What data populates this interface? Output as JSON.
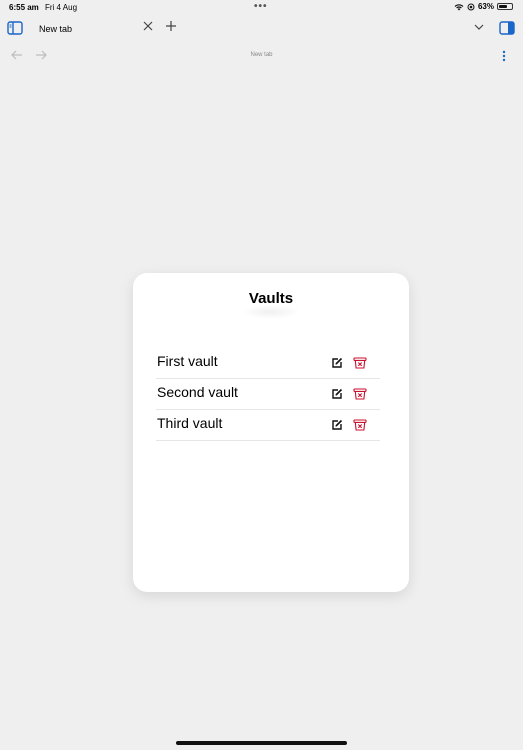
{
  "status": {
    "time": "6:55 am",
    "date": "Fri 4 Aug",
    "battery": "63%",
    "battery_level": 0.63
  },
  "tab": {
    "title": "New tab"
  },
  "navigation": {
    "title": "New tab"
  },
  "vaults": {
    "title": "Vaults",
    "items": [
      {
        "name": "First vault"
      },
      {
        "name": "Second vault"
      },
      {
        "name": "Third vault"
      }
    ]
  },
  "colors": {
    "accent_blue": "#1a66c9",
    "delete_red": "#c8102e"
  },
  "icons": {
    "sidebar": "sidebar-icon",
    "close": "close-icon",
    "new_tab": "plus-icon",
    "chevron": "chevron-down-icon",
    "tab_overview": "tab-overview-icon",
    "back": "back-arrow-icon",
    "forward": "forward-arrow-icon",
    "menu": "more-vertical-icon",
    "edit": "edit-icon",
    "delete": "trash-icon"
  }
}
